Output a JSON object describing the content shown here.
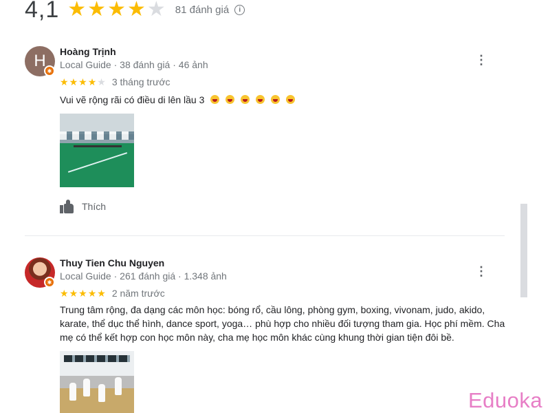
{
  "header": {
    "score": "4,1",
    "stars": [
      true,
      true,
      true,
      true,
      false
    ],
    "review_count": "81 đánh giá",
    "info_icon": "info-icon"
  },
  "reviews": [
    {
      "avatar_letter": "H",
      "name": "Hoàng Trịnh",
      "meta": "Local Guide · 38 đánh giá · 46 ảnh",
      "stars": [
        true,
        true,
        true,
        true,
        false
      ],
      "time": "3 tháng trước",
      "text": "Vui vẽ rộng rãi có điều di lên lầu 3",
      "emoji_count": 6,
      "photo": "badminton-court-photo",
      "like_label": "Thích"
    },
    {
      "name": "Thuy Tien Chu Nguyen",
      "meta": "Local Guide · 261 đánh giá · 1.348 ảnh",
      "stars": [
        true,
        true,
        true,
        true,
        true
      ],
      "time": "2 năm trước",
      "text_lines": [
        "Trung tâm rộng, đa dạng các môn học: bóng rổ, cầu lông, phòng gym, boxing, vivonam, judo, akido,",
        "karate, thể dục thể hình, dance sport, yoga… phù hợp cho nhiều đối tượng tham gia. Học phí mềm. Cha",
        "mẹ có thể kết hợp con học môn này, cha mẹ học môn khác cùng khung thời gian tiện đôi bề."
      ],
      "photo": "martial-arts-class-photo"
    }
  ],
  "watermark": "Eduoka",
  "colors": {
    "star": "#fbbc04",
    "star_empty": "#dadce0",
    "badge": "#e8710a",
    "watermark": "#e77ec6"
  }
}
